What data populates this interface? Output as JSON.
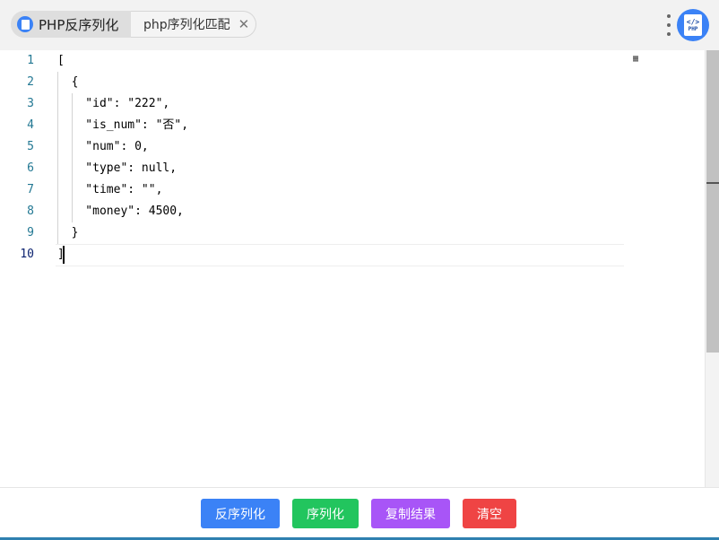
{
  "tabs": [
    {
      "label": "PHP反序列化",
      "active": true,
      "icon": "php-doc-icon"
    },
    {
      "label": "php序列化匹配",
      "active": false,
      "close_icon": "close-icon"
    }
  ],
  "header": {
    "menu_icon": "kebab-menu-icon",
    "logo": {
      "code_glyph": "</>",
      "text": "PHP"
    }
  },
  "editor": {
    "lines": [
      {
        "number": "1",
        "text": "["
      },
      {
        "number": "2",
        "text": "  {"
      },
      {
        "number": "3",
        "text": "    \"id\": \"222\","
      },
      {
        "number": "4",
        "text": "    \"is_num\": \"否\","
      },
      {
        "number": "5",
        "text": "    \"num\": 0,"
      },
      {
        "number": "6",
        "text": "    \"type\": null,"
      },
      {
        "number": "7",
        "text": "    \"time\": \"\","
      },
      {
        "number": "8",
        "text": "    \"money\": 4500,"
      },
      {
        "number": "9",
        "text": "  }"
      },
      {
        "number": "10",
        "text": "]"
      }
    ],
    "current_line": 10
  },
  "actions": {
    "unserialize": "反序列化",
    "serialize": "序列化",
    "copy_result": "复制结果",
    "clear": "清空"
  },
  "colors": {
    "unserialize": "#3b82f6",
    "serialize": "#22c55e",
    "copy_result": "#a855f7",
    "clear": "#ef4444",
    "line_number": "#237893",
    "accent": "#3b82f6"
  }
}
